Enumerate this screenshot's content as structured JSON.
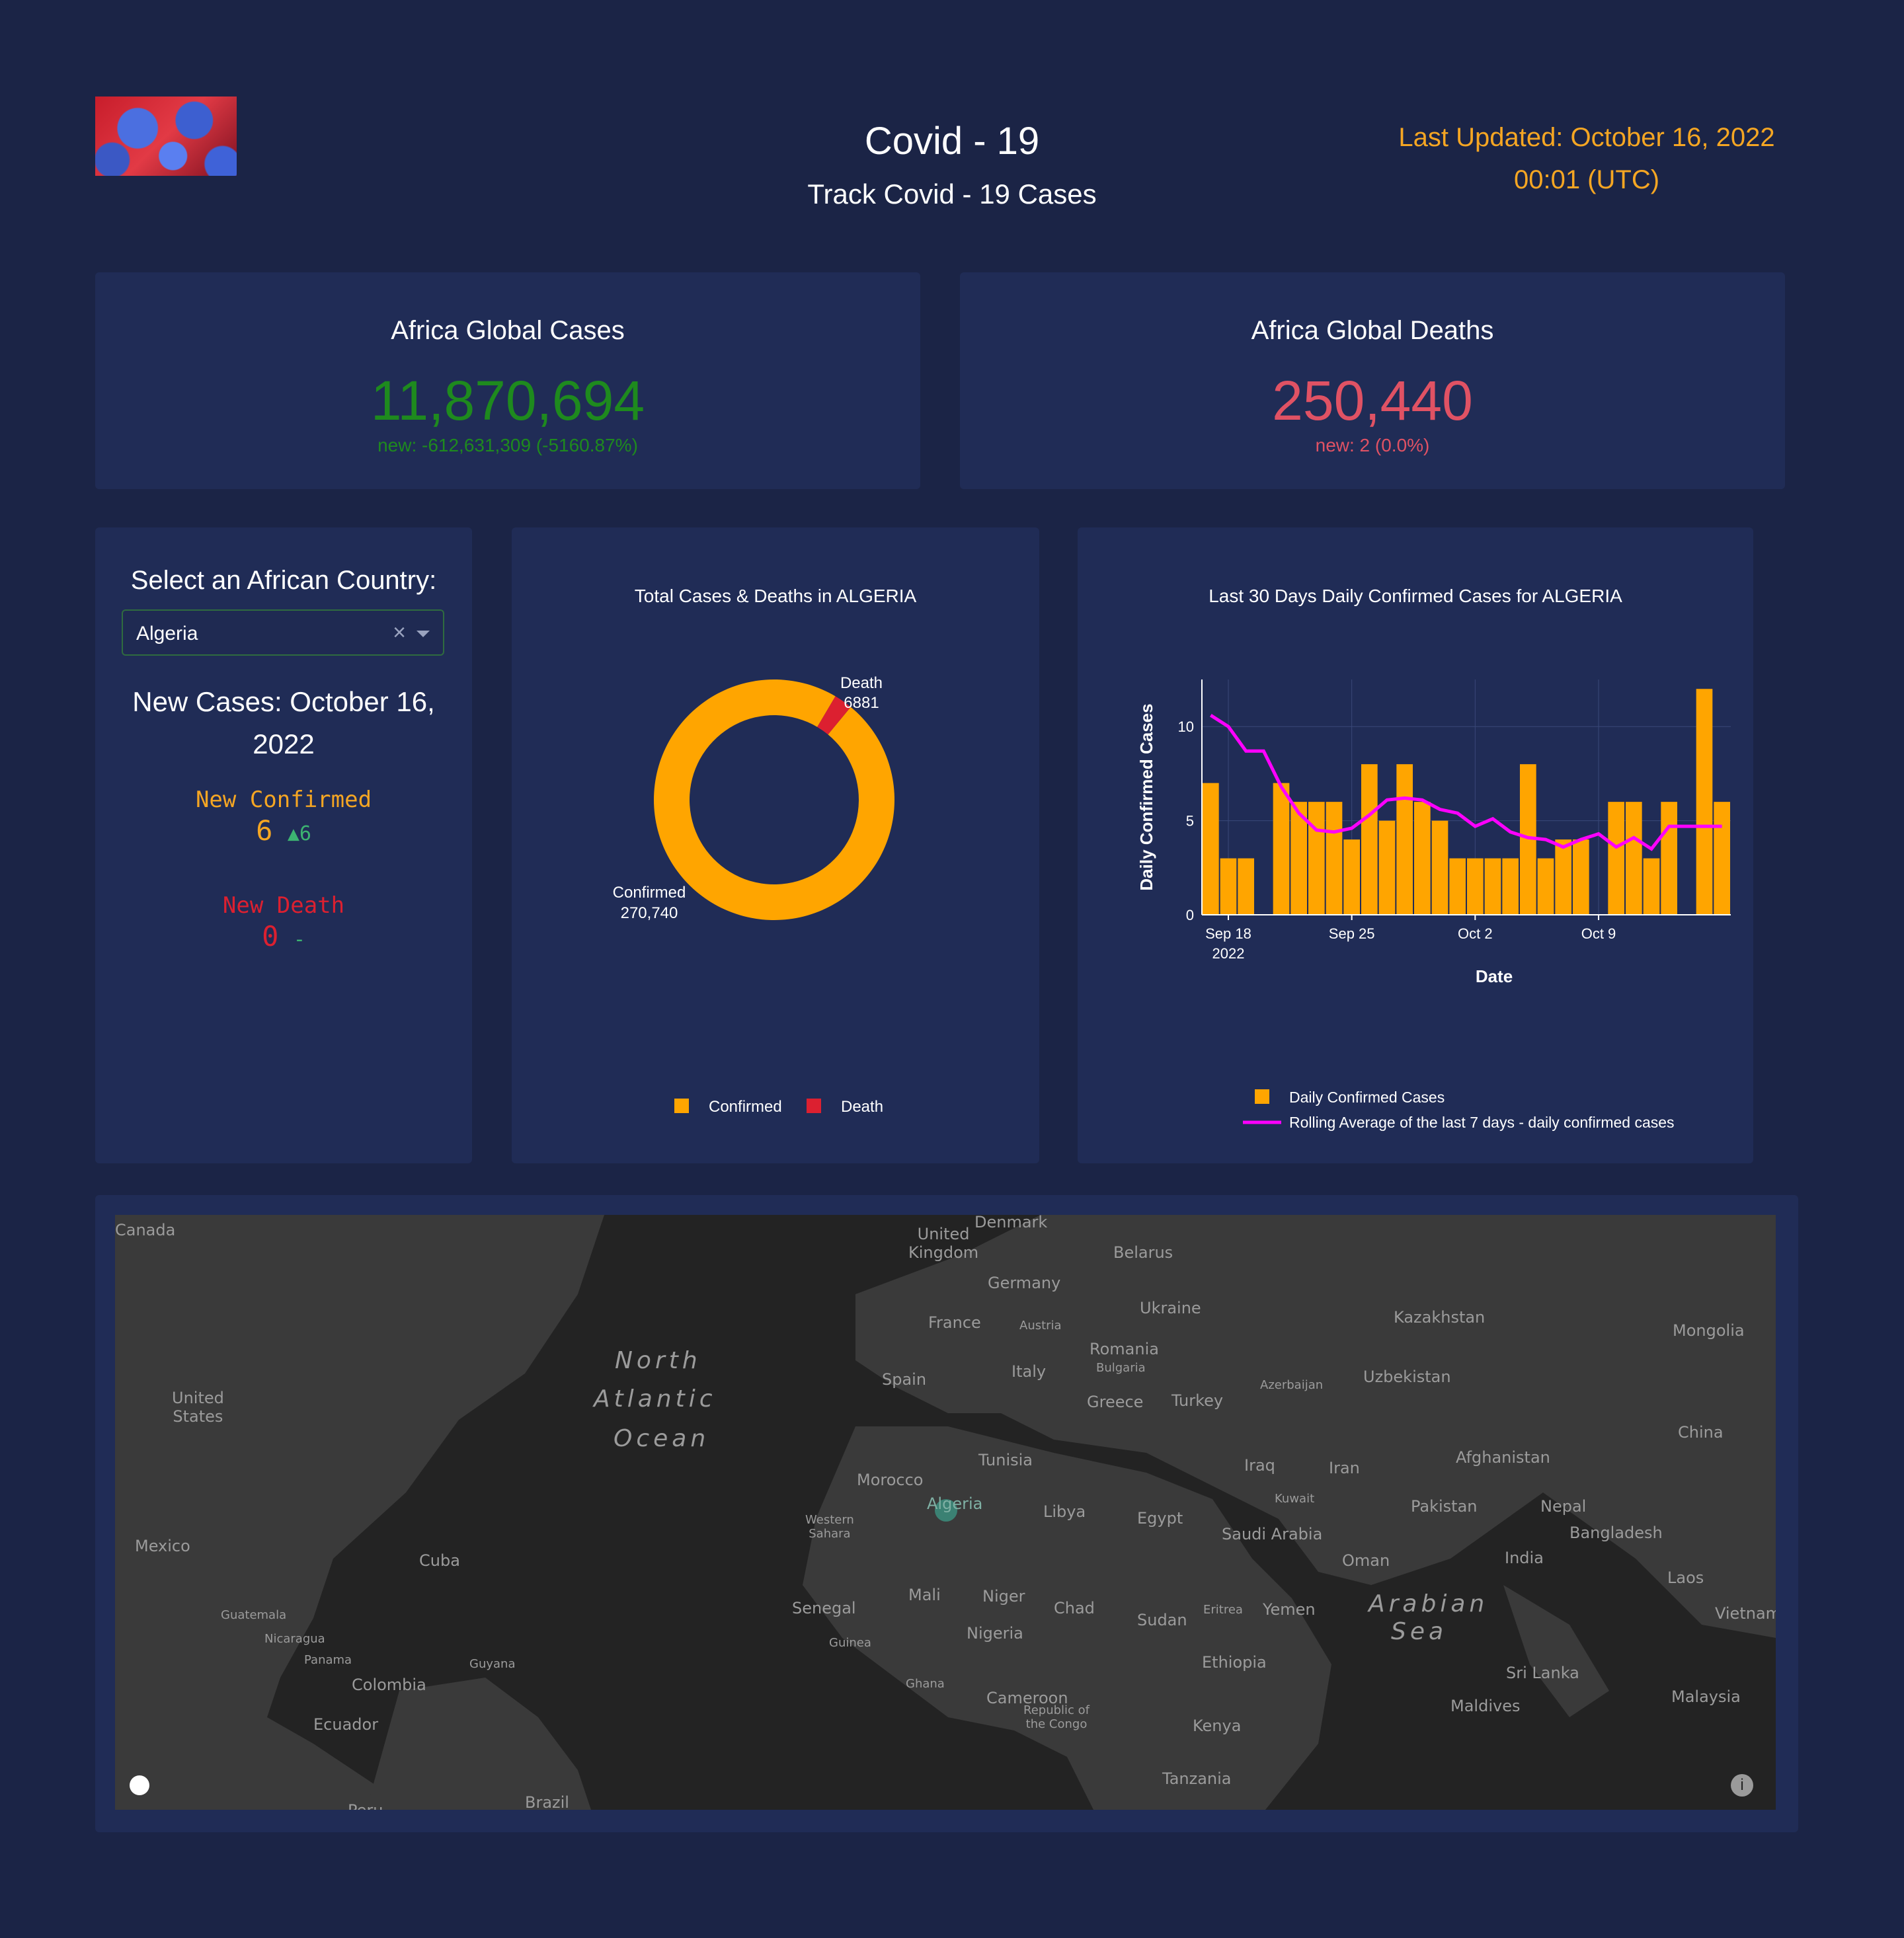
{
  "header": {
    "title": "Covid - 19",
    "subtitle": "Track Covid - 19 Cases",
    "last_updated_line1": "Last Updated: October 16, 2022",
    "last_updated_line2": "00:01 (UTC)"
  },
  "kpis": {
    "cases": {
      "title": "Africa Global Cases",
      "value": "11,870,694",
      "new": "new: -612,631,309 (-5160.87%)",
      "color": "#1e8a1e"
    },
    "deaths": {
      "title": "Africa Global Deaths",
      "value": "250,440",
      "new": "new: 2 (0.0%)",
      "color": "#e05264"
    }
  },
  "selector": {
    "title": "Select an African Country:",
    "selected": "Algeria",
    "clear_symbol": "×",
    "new_cases_line1": "New Cases: October 16,",
    "new_cases_line2": "2022",
    "new_confirmed_label": "New Confirmed",
    "new_confirmed_value": "6",
    "new_confirmed_delta": "▲6",
    "new_death_label": "New Death",
    "new_death_value": "0",
    "new_death_delta": "-"
  },
  "colors": {
    "confirmed": "#ffa500",
    "death": "#dc2030",
    "rolling": "#ff00ff",
    "orange_text": "#f5a623",
    "death_text": "#dc2030",
    "delta_green": "#3cb371"
  },
  "chart_data": [
    {
      "type": "pie",
      "title": "Total Cases & Deaths in  ALGERIA",
      "labels": [
        "Confirmed",
        "Death"
      ],
      "values": [
        270740,
        6881
      ],
      "slice_labels": [
        "Confirmed\n270,740",
        "Death\n6881"
      ],
      "confirmed_label_1": "Confirmed",
      "confirmed_label_2": "270,740",
      "death_label_1": "Death",
      "death_label_2": "6881",
      "legend": [
        "Confirmed",
        "Death"
      ],
      "legend_position": "bottom"
    },
    {
      "type": "bar",
      "title": "Last 30 Days Daily Confirmed Cases for  ALGERIA",
      "xlabel": "Date",
      "ylabel": "Daily Confirmed Cases",
      "ylim": [
        0,
        12.5
      ],
      "yticks": [
        "0",
        "5",
        "10"
      ],
      "xticks": [
        "Sep 18",
        "Sep 25",
        "Oct 2",
        "Oct 9"
      ],
      "xtick_year": "2022",
      "x": [
        "2022-09-17",
        "2022-09-18",
        "2022-09-19",
        "2022-09-20",
        "2022-09-21",
        "2022-09-22",
        "2022-09-23",
        "2022-09-24",
        "2022-09-25",
        "2022-09-26",
        "2022-09-27",
        "2022-09-28",
        "2022-09-29",
        "2022-09-30",
        "2022-10-01",
        "2022-10-02",
        "2022-10-03",
        "2022-10-04",
        "2022-10-05",
        "2022-10-06",
        "2022-10-07",
        "2022-10-08",
        "2022-10-09",
        "2022-10-10",
        "2022-10-11",
        "2022-10-12",
        "2022-10-13",
        "2022-10-14",
        "2022-10-15",
        "2022-10-16"
      ],
      "series": [
        {
          "name": "Daily Confirmed Cases",
          "values": [
            7,
            3,
            3,
            0,
            7,
            6,
            6,
            6,
            4,
            8,
            5,
            8,
            6,
            5,
            3,
            3,
            3,
            3,
            8,
            3,
            4,
            4,
            0,
            6,
            6,
            3,
            6,
            0,
            12,
            6
          ]
        },
        {
          "name": "Rolling Average of the last 7 days - daily confirmed cases",
          "values": [
            10.6,
            10.0,
            8.7,
            8.7,
            6.8,
            5.4,
            4.5,
            4.4,
            4.6,
            5.3,
            6.1,
            6.2,
            6.1,
            5.6,
            5.4,
            4.7,
            5.1,
            4.4,
            4.1,
            4.0,
            3.6,
            4.0,
            4.3,
            3.6,
            4.1,
            3.5,
            4.7,
            4.7,
            4.7,
            4.7
          ]
        }
      ],
      "legend_position": "bottom"
    }
  ],
  "map": {
    "labels": [
      "Canada",
      "United\nKingdom",
      "Denmark",
      "Belarus",
      "Germany",
      "Ukraine",
      "France",
      "Austria",
      "Kazakhstan",
      "Mongolia",
      "Romania",
      "Bulgaria",
      "Italy",
      "Uzbekistan",
      "Spain",
      "Azerbaijan",
      "Greece",
      "Turkey",
      "United\nStates",
      "North",
      "Atlantic",
      "Ocean",
      "China",
      "Tunisia",
      "Afghanistan",
      "Iraq",
      "Iran",
      "Morocco",
      "Kuwait",
      "Algeria",
      "Libya",
      "Egypt",
      "Pakistan",
      "Nepal",
      "Mexico",
      "Western\nSahara",
      "Saudi Arabia",
      "Bangladesh",
      "Cuba",
      "India",
      "Oman",
      "Laos",
      "Mali",
      "Niger",
      "Senegal",
      "Chad",
      "Sudan",
      "Eritrea",
      "Yemen",
      "Arabian",
      "Sea",
      "Vietnam",
      "Guatemala",
      "Nicaragua",
      "Guinea",
      "Nigeria",
      "Ethiopia",
      "Panama",
      "Guyana",
      "Ghana",
      "Sri Lanka",
      "Colombia",
      "Cameroon",
      "Republic of\nthe Congo",
      "Maldives",
      "Malaysia",
      "Kenya",
      "Ecuador",
      "Tanzania",
      "Brazil",
      "Peru"
    ]
  }
}
